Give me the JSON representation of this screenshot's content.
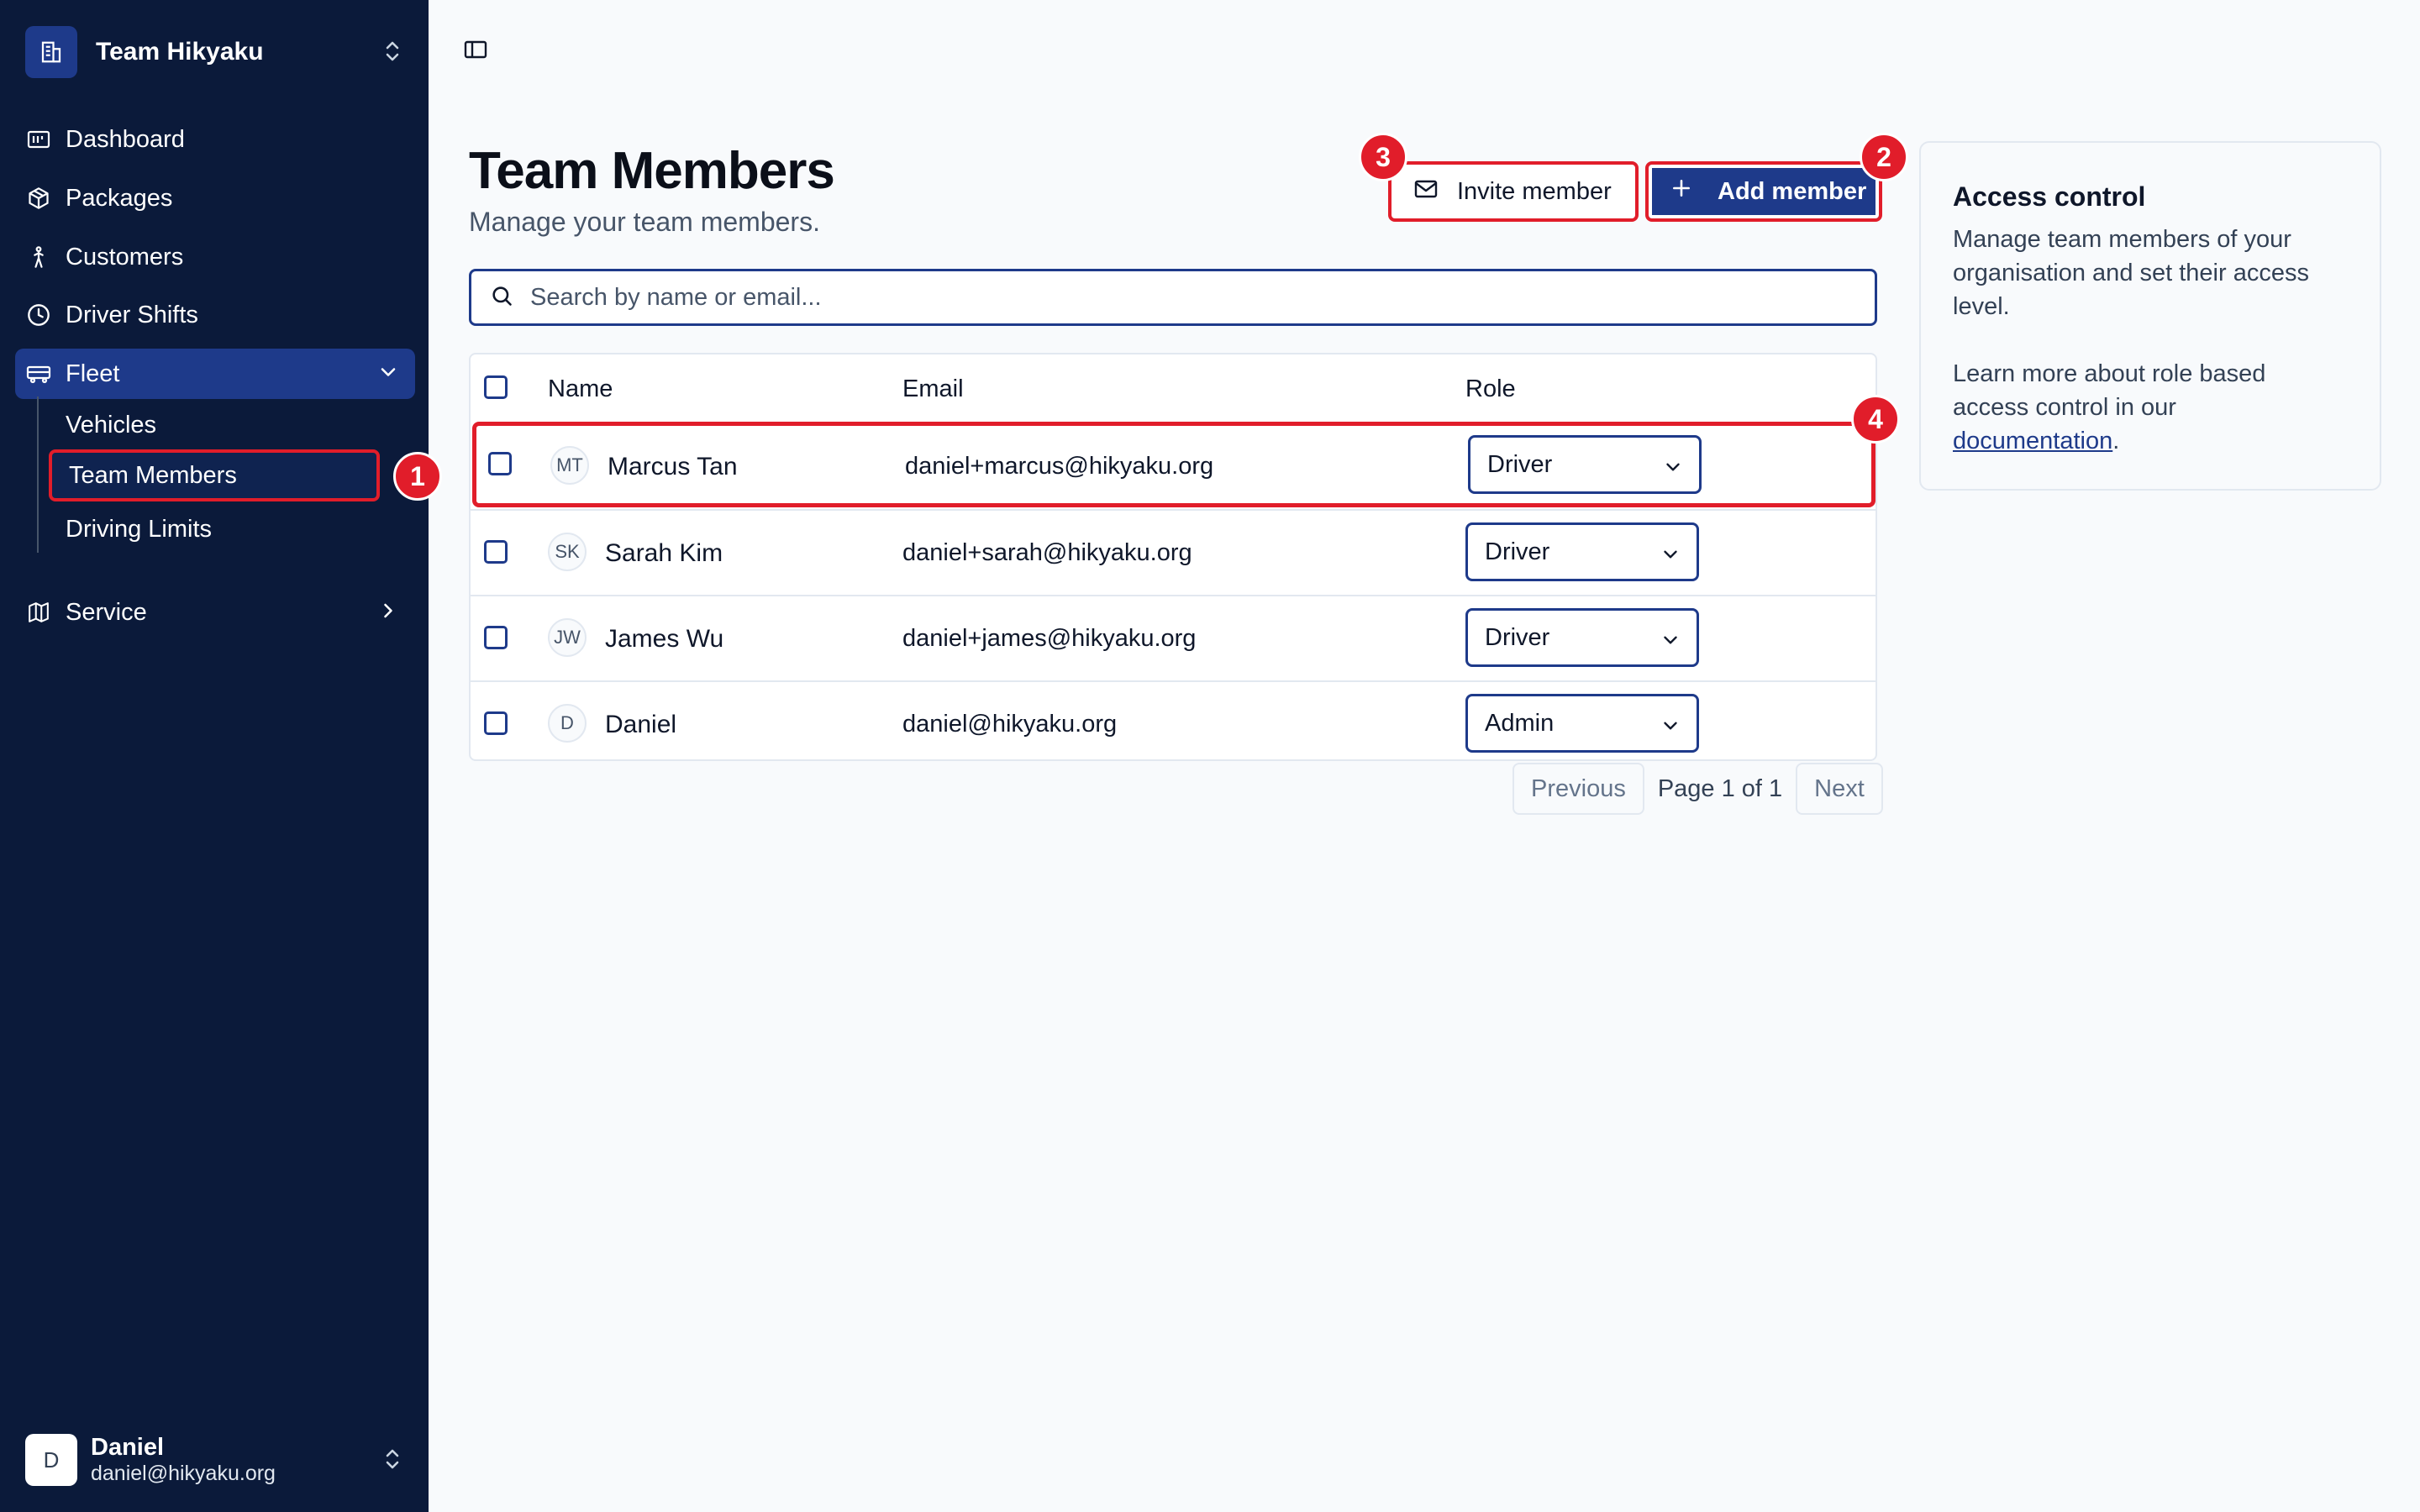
{
  "sidebar": {
    "team_name": "Team Hikyaku",
    "items": [
      {
        "label": "Dashboard",
        "icon": "dashboard-icon"
      },
      {
        "label": "Packages",
        "icon": "package-icon"
      },
      {
        "label": "Customers",
        "icon": "customers-icon"
      },
      {
        "label": "Driver Shifts",
        "icon": "clock-icon"
      },
      {
        "label": "Fleet",
        "icon": "truck-icon"
      },
      {
        "label": "Service",
        "icon": "map-icon"
      }
    ],
    "fleet_subitems": [
      {
        "label": "Vehicles"
      },
      {
        "label": "Team Members"
      },
      {
        "label": "Driving Limits"
      }
    ],
    "user": {
      "initial": "D",
      "name": "Daniel",
      "email": "daniel@hikyaku.org"
    }
  },
  "main": {
    "title": "Team Members",
    "subtitle": "Manage your team members.",
    "invite_label": "Invite member",
    "add_label": "Add member",
    "search_placeholder": "Search by name or email...",
    "table": {
      "headers": [
        "Name",
        "Email",
        "Role"
      ],
      "rows": [
        {
          "initials": "MT",
          "name": "Marcus Tan",
          "email": "daniel+marcus@hikyaku.org",
          "role": "Driver"
        },
        {
          "initials": "SK",
          "name": "Sarah Kim",
          "email": "daniel+sarah@hikyaku.org",
          "role": "Driver"
        },
        {
          "initials": "JW",
          "name": "James Wu",
          "email": "daniel+james@hikyaku.org",
          "role": "Driver"
        },
        {
          "initials": "D",
          "name": "Daniel",
          "email": "daniel@hikyaku.org",
          "role": "Admin"
        }
      ]
    },
    "pagination": {
      "previous": "Previous",
      "page_text": "Page 1 of 1",
      "next": "Next"
    }
  },
  "access_card": {
    "title": "Access control",
    "text": "Manage team members of your organisation and set their access level.",
    "learn_prefix": "Learn more about role based access control in our ",
    "link_text": "documentation",
    "learn_suffix": "."
  },
  "annotations": [
    "1",
    "2",
    "3",
    "4"
  ],
  "colors": {
    "sidebar_bg": "#0b1a3a",
    "accent": "#1e3a8a",
    "highlight": "#e11d2a",
    "page_bg": "#f8fafc"
  }
}
